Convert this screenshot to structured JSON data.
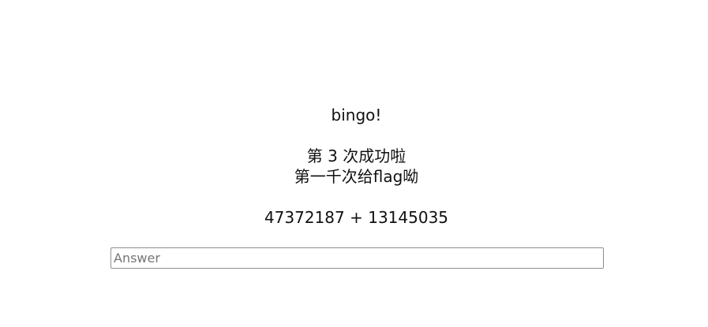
{
  "message": {
    "status": "bingo!",
    "success_line": "第 3 次成功啦",
    "hint_line": "第一千次给flag呦"
  },
  "problem": {
    "equation": "47372187 + 13145035"
  },
  "answer": {
    "value": "",
    "placeholder": "Answer"
  }
}
